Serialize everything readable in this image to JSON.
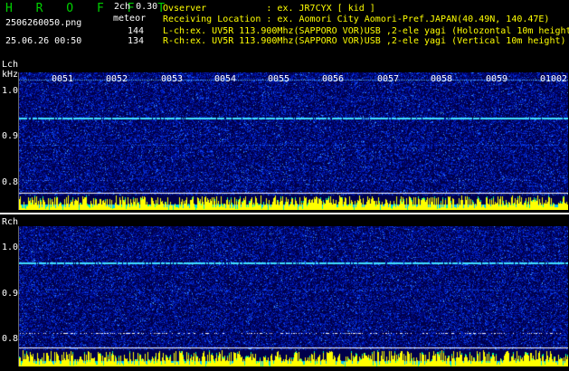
{
  "app": {
    "title": "H R O F F T",
    "mode": "2ch 0.30",
    "filename": "2506260050.png",
    "datetime": "25.06.26 00:50",
    "meteor_label": "meteor",
    "lch_count": "144",
    "rch_count": "134"
  },
  "header": {
    "observer": "Ovserver           : ex. JR7CYX [ kid ]",
    "location": "Receiving Location : ex. Aomori City Aomori-Pref.JAPAN(40.49N, 140.47E)",
    "lch_info": "L-ch:ex. UV5R 113.900Mhz(SAPPORO VOR)USB ,2-ele yagi (Holozontal 10m height)",
    "rch_info": "R-ch:ex. UV5R 113.900Mhz(SAPPORO VOR)USB ,2-ele yagi (Vertical 10m height)"
  },
  "lch": {
    "label": "Lch",
    "unit": "kHz",
    "ticks": [
      "1.0",
      "0.9",
      "0.8"
    ]
  },
  "rch": {
    "label": "Rch",
    "ticks": [
      "1.0",
      "0.9",
      "0.8"
    ]
  },
  "time_labels": [
    "0051",
    "0052",
    "0053",
    "0054",
    "0055",
    "0056",
    "0057",
    "0058",
    "0059",
    "0100",
    "2"
  ],
  "colors": {
    "title_green": "#00d000",
    "header_yellow": "#ffff00",
    "background_dark_blue": "#000060",
    "signal_cyan": "#40e0ff",
    "bar_yellow": "#ffff00"
  }
}
